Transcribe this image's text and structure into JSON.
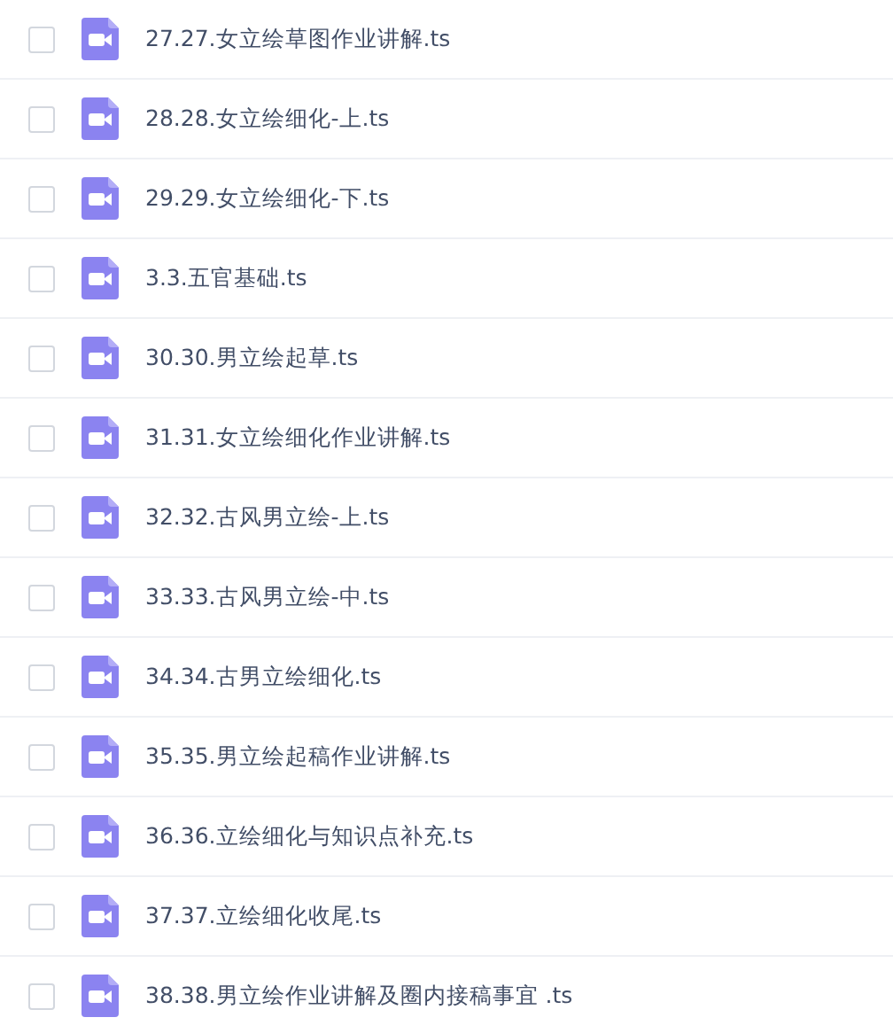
{
  "files": [
    {
      "name": "27.27.女立绘草图作业讲解.ts",
      "checked": false
    },
    {
      "name": "28.28.女立绘细化-上.ts",
      "checked": false
    },
    {
      "name": "29.29.女立绘细化-下.ts",
      "checked": false
    },
    {
      "name": "3.3.五官基础.ts",
      "checked": false
    },
    {
      "name": "30.30.男立绘起草.ts",
      "checked": false
    },
    {
      "name": "31.31.女立绘细化作业讲解.ts",
      "checked": false
    },
    {
      "name": "32.32.古风男立绘-上.ts",
      "checked": false
    },
    {
      "name": "33.33.古风男立绘-中.ts",
      "checked": false
    },
    {
      "name": "34.34.古男立绘细化.ts",
      "checked": false
    },
    {
      "name": "35.35.男立绘起稿作业讲解.ts",
      "checked": false
    },
    {
      "name": "36.36.立绘细化与知识点补充.ts",
      "checked": false
    },
    {
      "name": "37.37.立绘细化收尾.ts",
      "checked": false
    },
    {
      "name": "38.38.男立绘作业讲解及圈内接稿事宜 .ts",
      "checked": false
    }
  ]
}
